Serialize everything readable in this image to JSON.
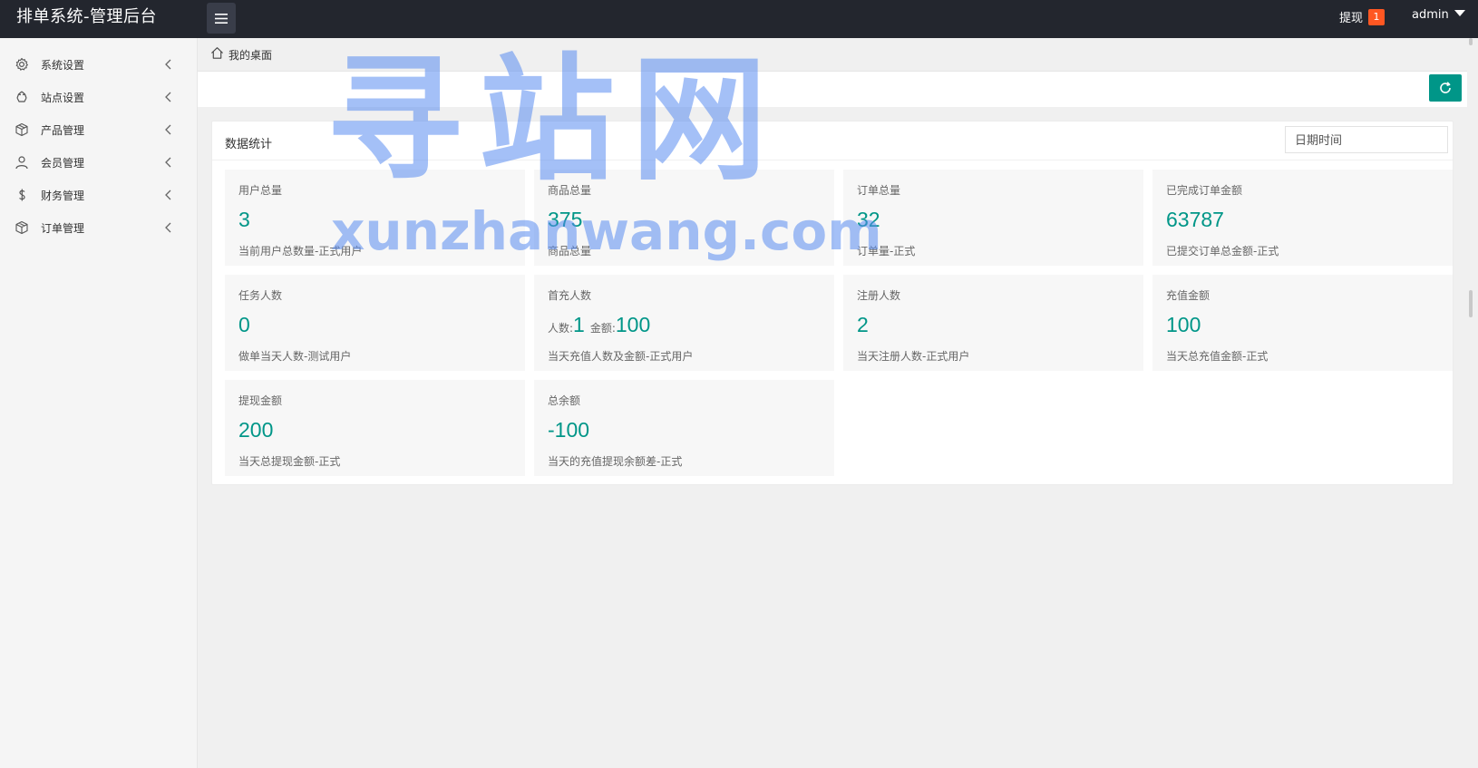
{
  "app": {
    "title": "排单系统-管理后台"
  },
  "header": {
    "menu_toggle_icon": "hamburger-icon",
    "withdraw_label": "提现",
    "withdraw_count": "1",
    "username": "admin"
  },
  "sidebar": {
    "items": [
      {
        "label": "系统设置",
        "icon": "gear-icon"
      },
      {
        "label": "站点设置",
        "icon": "recycle-icon"
      },
      {
        "label": "产品管理",
        "icon": "package-icon"
      },
      {
        "label": "会员管理",
        "icon": "user-icon"
      },
      {
        "label": "财务管理",
        "icon": "dollar-icon"
      },
      {
        "label": "订单管理",
        "icon": "package-icon"
      }
    ]
  },
  "breadcrumb": {
    "label": "我的桌面",
    "icon": "home-icon"
  },
  "toolbar": {
    "refresh_icon": "refresh-icon"
  },
  "stats": {
    "title": "数据统计",
    "date_placeholder": "日期时间",
    "cards": [
      {
        "title": "用户总量",
        "value": "3",
        "desc": "当前用户总数量-正式用户"
      },
      {
        "title": "商品总量",
        "value": "375",
        "desc": "商品总量"
      },
      {
        "title": "订单总量",
        "value": "32",
        "desc": "订单量-正式"
      },
      {
        "title": "已完成订单金额",
        "value": "63787",
        "desc": "已提交订单总金额-正式"
      },
      {
        "title": "任务人数",
        "value": "0",
        "desc": "做单当天人数-测试用户"
      },
      {
        "title": "首充人数",
        "people_label": "人数:",
        "people_value": "1",
        "amount_label": "金额:",
        "amount_value": "100",
        "desc": "当天充值人数及金额-正式用户"
      },
      {
        "title": "注册人数",
        "value": "2",
        "desc": "当天注册人数-正式用户"
      },
      {
        "title": "充值金额",
        "value": "100",
        "desc": "当天总充值金额-正式"
      },
      {
        "title": "提现金额",
        "value": "200",
        "desc": "当天总提现金额-正式"
      },
      {
        "title": "总余额",
        "value": "-100",
        "desc": "当天的充值提现余额差-正式"
      }
    ]
  },
  "watermark": {
    "cn": "寻站网",
    "url": "xunzhanwang.com"
  },
  "colors": {
    "accent": "#009688",
    "badge": "#ff5722",
    "topbar": "#23262e"
  }
}
